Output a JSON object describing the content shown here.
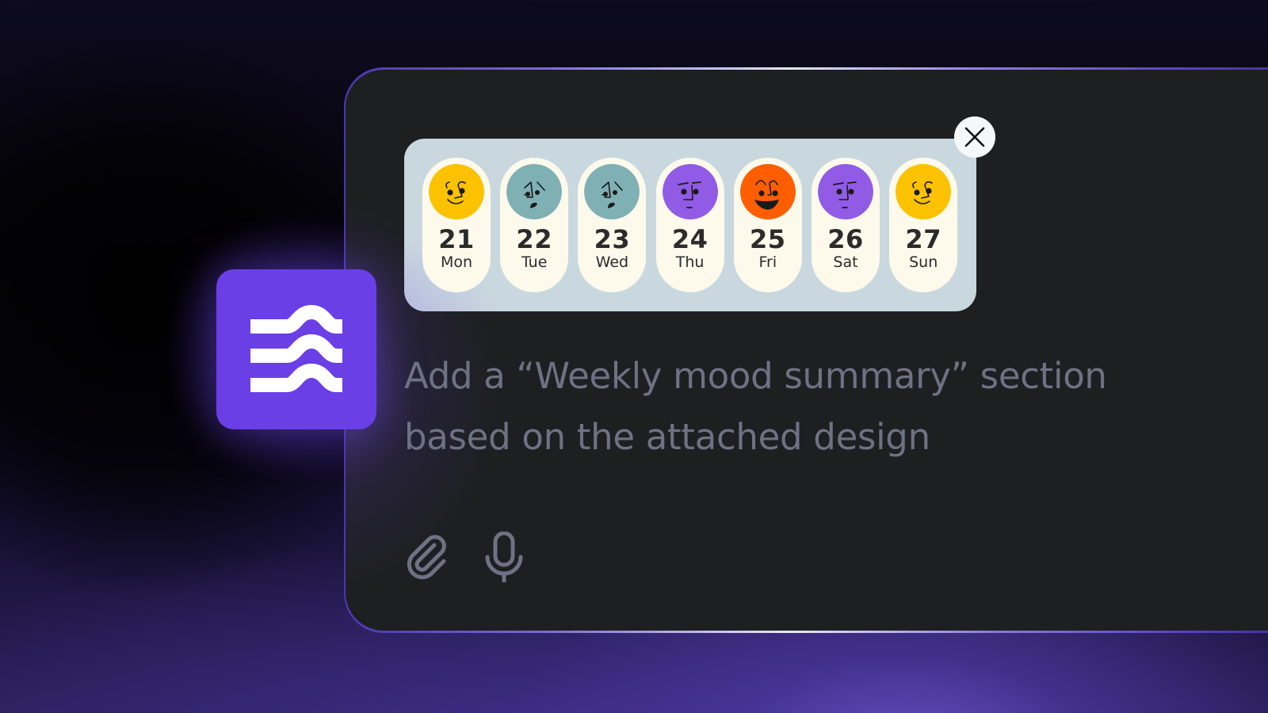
{
  "attachment": {
    "days": [
      {
        "num": "21",
        "name": "Mon",
        "mood": "content",
        "color": "#fcc200"
      },
      {
        "num": "22",
        "name": "Tue",
        "mood": "sad",
        "color": "#7eb0b4"
      },
      {
        "num": "23",
        "name": "Wed",
        "mood": "sad",
        "color": "#7eb0b4"
      },
      {
        "num": "24",
        "name": "Thu",
        "mood": "neutral",
        "color": "#915be6"
      },
      {
        "num": "25",
        "name": "Fri",
        "mood": "happy",
        "color": "#ff5e00"
      },
      {
        "num": "26",
        "name": "Sat",
        "mood": "neutral",
        "color": "#915be6"
      },
      {
        "num": "27",
        "name": "Sun",
        "mood": "content",
        "color": "#fcc200"
      }
    ],
    "close_icon": "close-icon"
  },
  "logo": {
    "icon": "waves-logo-icon",
    "color": "#6a3fe6"
  },
  "prompt": {
    "line1": "Add a “Weekly mood summary” section",
    "line2": "based on the attached design"
  },
  "toolbar": {
    "attach_icon": "paperclip-icon",
    "mic_icon": "microphone-icon"
  },
  "colors": {
    "card_bg": "#1e1f21",
    "panel_bg": "#c9d8de",
    "pill_bg": "#fdfaec",
    "text_muted": "#6f7184",
    "accent": "#6a3fe6"
  }
}
